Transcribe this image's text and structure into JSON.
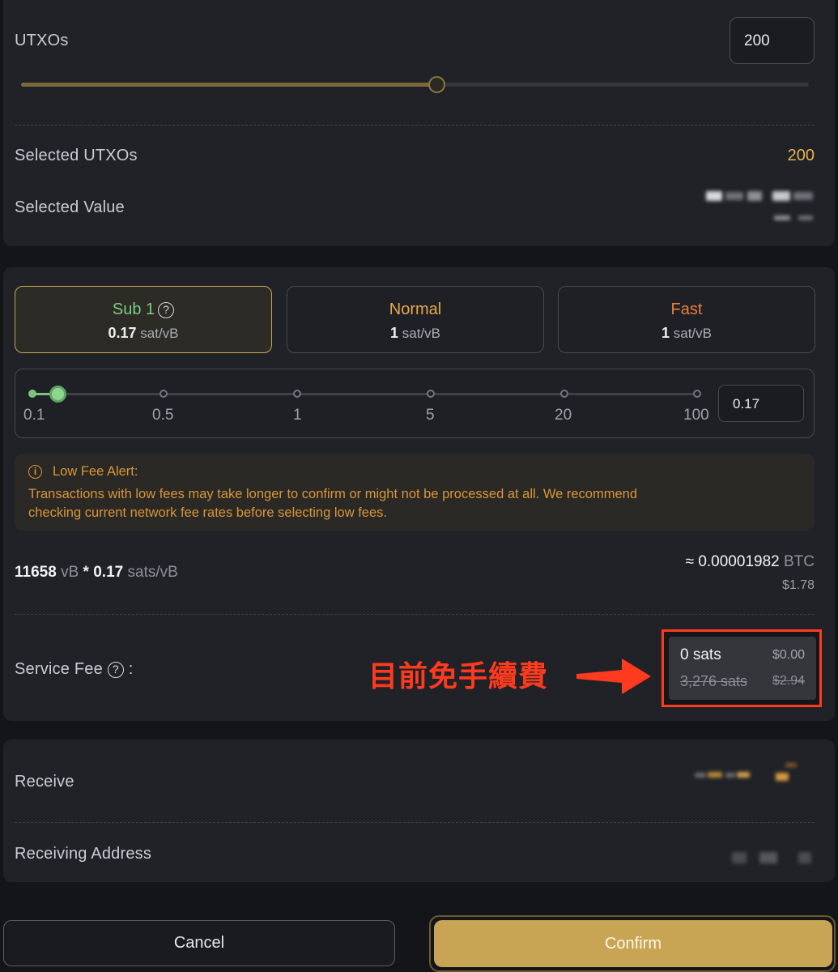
{
  "utxos": {
    "label": "UTXOs",
    "input_value": "200",
    "slider_fraction": 0.528
  },
  "selected": {
    "utxos_label": "Selected UTXOs",
    "utxos_value": "200",
    "value_label": "Selected Value"
  },
  "speeds": [
    {
      "name": "Sub 1",
      "rate_value": "0.17",
      "rate_unit": "sat/vB",
      "color": "#7ccd83"
    },
    {
      "name": "Normal",
      "rate_value": "1",
      "rate_unit": "sat/vB",
      "color": "#e6a74a"
    },
    {
      "name": "Fast",
      "rate_value": "1",
      "rate_unit": "sat/vB",
      "color": "#ee7f38"
    }
  ],
  "fee_slider": {
    "ticks": [
      "0.1",
      "0.5",
      "1",
      "5",
      "20",
      "100"
    ],
    "input_value": "0.17"
  },
  "alert": {
    "icon": "info-icon",
    "title": "Low Fee Alert:",
    "line1": "Transactions with low fees may take longer to confirm or might not be processed at all. We recommend",
    "line2": "checking current network fee rates before selecting low fees."
  },
  "calc": {
    "vbytes": "11658",
    "vb_unit": "vB",
    "times": "*",
    "rate": "0.17",
    "rate_unit": "sats/vB",
    "approx_prefix": "≈",
    "btc_value": "0.00001982",
    "btc_unit": "BTC",
    "usd": "$1.78"
  },
  "service_fee": {
    "label": "Service Fee",
    "colon": ":",
    "sats": "0 sats",
    "usd": "$0.00",
    "old_sats": "3,276 sats",
    "old_usd": "$2.94",
    "annotation": "目前免手續費",
    "annotation_color": "#ff3b1f"
  },
  "receive": {
    "label": "Receive",
    "address_label": "Receiving Address"
  },
  "buttons": {
    "cancel": "Cancel",
    "confirm": "Confirm"
  },
  "colors": {
    "accent_gold": "#c8a555",
    "sub1_green": "#7ccd83",
    "alert_orange": "#d9953a"
  }
}
